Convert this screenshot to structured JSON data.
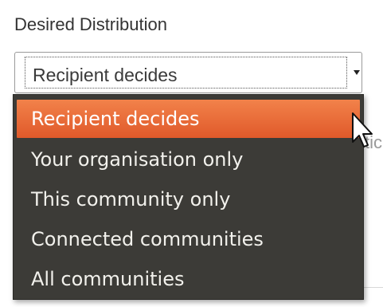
{
  "field": {
    "label": "Desired Distribution",
    "selected_value": "Recipient decides"
  },
  "dropdown": {
    "options": [
      {
        "label": "Recipient decides",
        "selected": true
      },
      {
        "label": "Your organisation only",
        "selected": false
      },
      {
        "label": "This community only",
        "selected": false
      },
      {
        "label": "Connected communities",
        "selected": false
      },
      {
        "label": "All communities",
        "selected": false
      }
    ],
    "highlight_color": "#e8683a",
    "background_color": "#3c3b37"
  },
  "background": {
    "partial_text": "tic"
  },
  "icons": {
    "select_arrow": "chevron-down-icon",
    "pointer": "mouse-pointer-icon"
  }
}
